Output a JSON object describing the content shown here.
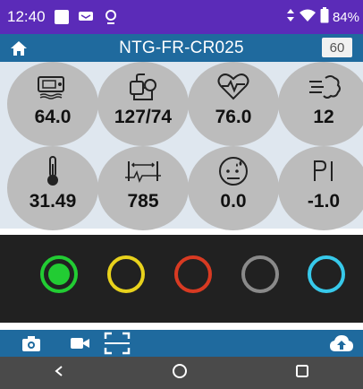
{
  "status_bar": {
    "time": "12:40",
    "battery_percent": "84%",
    "icons": [
      "notification-square-icon",
      "message-icon",
      "location-pin-icon",
      "data-arrows-icon",
      "wifi-icon",
      "battery-icon"
    ]
  },
  "app_bar": {
    "title": "NTG-FR-CR025",
    "badge_value": "60",
    "home_icon": "home-icon"
  },
  "vitals": [
    {
      "name": "blood-pressure-monitor",
      "icon": "bp-monitor-icon",
      "value": "64.0"
    },
    {
      "name": "blood-pressure-cuff",
      "icon": "bp-cuff-icon",
      "value": "127/74"
    },
    {
      "name": "heart-rate",
      "icon": "heart-ekg-icon",
      "value": "76.0"
    },
    {
      "name": "respiration",
      "icon": "breath-icon",
      "value": "12"
    },
    {
      "name": "temperature",
      "icon": "thermometer-icon",
      "value": "31.49"
    },
    {
      "name": "interval",
      "icon": "interval-icon",
      "value": "785"
    },
    {
      "name": "sweat",
      "icon": "sweat-face-icon",
      "value": "0.0"
    },
    {
      "name": "pi",
      "icon": "pi-icon",
      "value": "-1.0"
    }
  ],
  "indicators": [
    {
      "name": "green",
      "color": "#22cc33",
      "active": true
    },
    {
      "name": "yellow",
      "color": "#e8d21c",
      "active": false
    },
    {
      "name": "red",
      "color": "#d83a22",
      "active": false
    },
    {
      "name": "gray",
      "color": "#8a8a8a",
      "active": false
    },
    {
      "name": "cyan",
      "color": "#37c9ea",
      "active": false
    }
  ],
  "colors": {
    "status_bar": "#5b2bb8",
    "app_bar": "#1f6a9e",
    "grid_bg": "#dfe7ef",
    "vital_circle": "#bcbcbc",
    "strip_bg": "#212121",
    "nav_bar": "#4a4a4a"
  },
  "footer_icons": [
    "camera-icon",
    "video-icon",
    "scan-frame-icon",
    "cloud-upload-icon"
  ],
  "nav_icons": [
    "back-icon",
    "home-circle-icon",
    "recents-icon"
  ]
}
